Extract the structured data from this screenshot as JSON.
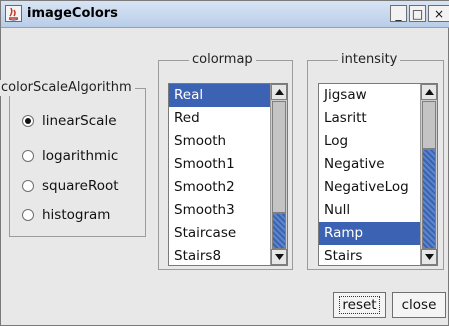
{
  "window": {
    "title": "imageColors"
  },
  "controls": {
    "minimize": "_",
    "maximize": "□",
    "close": "×"
  },
  "scale_group": {
    "legend": "colorScaleAlgorithm",
    "options": [
      {
        "label": "linearScale",
        "selected": true
      },
      {
        "label": "logarithmic",
        "selected": false
      },
      {
        "label": "squareRoot",
        "selected": false
      },
      {
        "label": "histogram",
        "selected": false
      }
    ]
  },
  "colormap_group": {
    "legend": "colormap",
    "items": [
      "Real",
      "Red",
      "Smooth",
      "Smooth1",
      "Smooth2",
      "Smooth3",
      "Staircase",
      "Stairs8"
    ],
    "selected": "Real"
  },
  "intensity_group": {
    "legend": "intensity",
    "items": [
      "Jigsaw",
      "Lasritt",
      "Log",
      "Negative",
      "NegativeLog",
      "Null",
      "Ramp",
      "Stairs"
    ],
    "selected": "Ramp"
  },
  "buttons": {
    "reset": "reset",
    "close": "close"
  }
}
